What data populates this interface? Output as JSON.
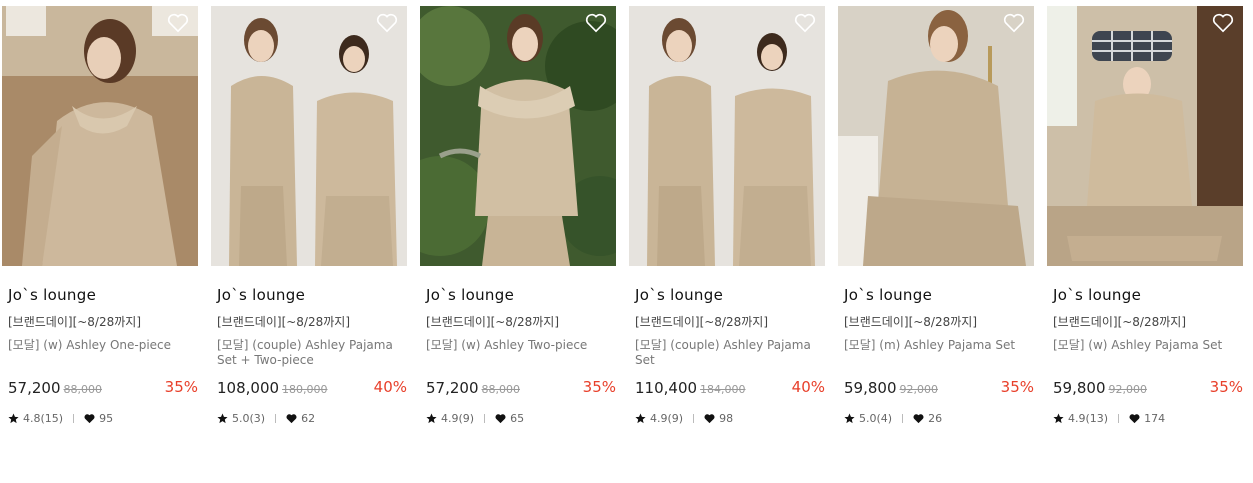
{
  "colors": {
    "accent_discount": "#e8402b",
    "text_main": "#222222",
    "text_muted": "#777777"
  },
  "icons": {
    "wishlist": "heart-outline-icon",
    "rating": "star-icon",
    "likes": "heart-icon"
  },
  "products": [
    {
      "brand": "Jo`s lounge",
      "tag": "[브랜드데이][~8/28까지]",
      "name": "[모달] (w) Ashley One-piece",
      "price": "57,200",
      "original_price": "88,000",
      "discount": "35%",
      "rating": "4.8(15)",
      "likes": "95"
    },
    {
      "brand": "Jo`s lounge",
      "tag": "[브랜드데이][~8/28까지]",
      "name": "[모달] (couple) Ashley Pajama Set + Two-piece",
      "price": "108,000",
      "original_price": "180,000",
      "discount": "40%",
      "rating": "5.0(3)",
      "likes": "62"
    },
    {
      "brand": "Jo`s lounge",
      "tag": "[브랜드데이][~8/28까지]",
      "name": "[모달] (w) Ashley Two-piece",
      "price": "57,200",
      "original_price": "88,000",
      "discount": "35%",
      "rating": "4.9(9)",
      "likes": "65"
    },
    {
      "brand": "Jo`s lounge",
      "tag": "[브랜드데이][~8/28까지]",
      "name": "[모달] (couple) Ashley Pajama Set",
      "price": "110,400",
      "original_price": "184,000",
      "discount": "40%",
      "rating": "4.9(9)",
      "likes": "98"
    },
    {
      "brand": "Jo`s lounge",
      "tag": "[브랜드데이][~8/28까지]",
      "name": "[모달] (m) Ashley Pajama Set",
      "price": "59,800",
      "original_price": "92,000",
      "discount": "35%",
      "rating": "5.0(4)",
      "likes": "26"
    },
    {
      "brand": "Jo`s lounge",
      "tag": "[브랜드데이][~8/28까지]",
      "name": "[모달] (w) Ashley Pajama Set",
      "price": "59,800",
      "original_price": "92,000",
      "discount": "35%",
      "rating": "4.9(13)",
      "likes": "174"
    }
  ]
}
